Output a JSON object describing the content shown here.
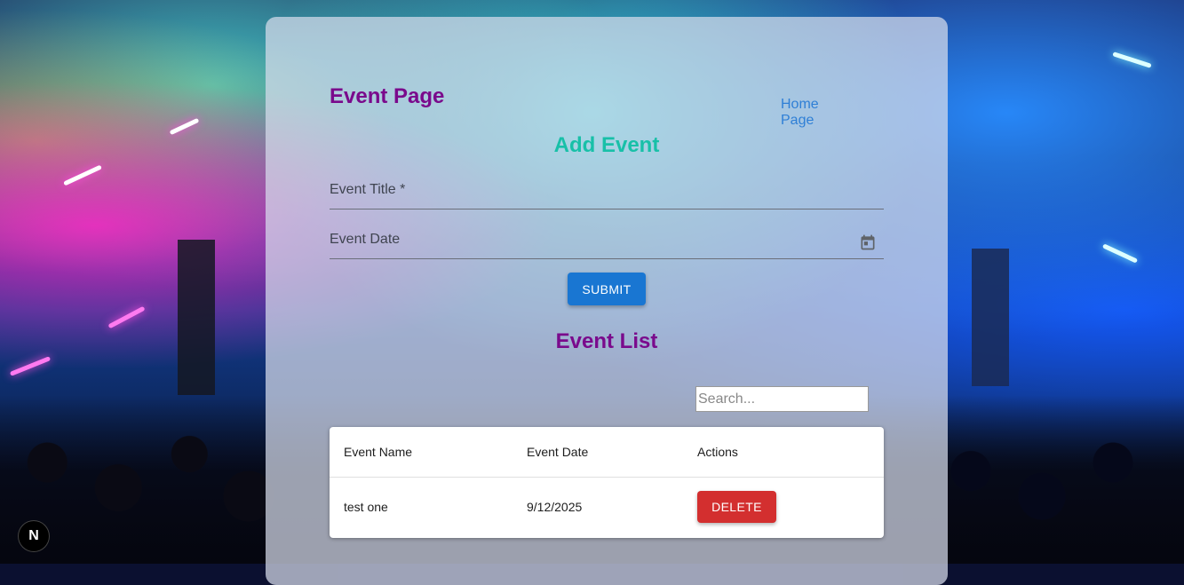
{
  "header": {
    "title": "Event Page",
    "home_link": "Home Page"
  },
  "add_event": {
    "title": "Add Event",
    "title_field_label": "Event Title *",
    "date_field_label": "Event Date",
    "submit_label": "SUBMIT"
  },
  "event_list": {
    "title": "Event List",
    "search_placeholder": "Search...",
    "columns": [
      "Event Name",
      "Event Date",
      "Actions"
    ],
    "rows": [
      {
        "name": "test one",
        "date": "9/12/2025",
        "action_label": "DELETE"
      }
    ]
  },
  "dev_badge": {
    "letter": "N"
  },
  "colors": {
    "accent_purple": "#7a0a8c",
    "accent_teal": "#18c0a8",
    "primary_button": "#1976d2",
    "danger_button": "#d32f2f",
    "link": "#2f7fd6"
  }
}
